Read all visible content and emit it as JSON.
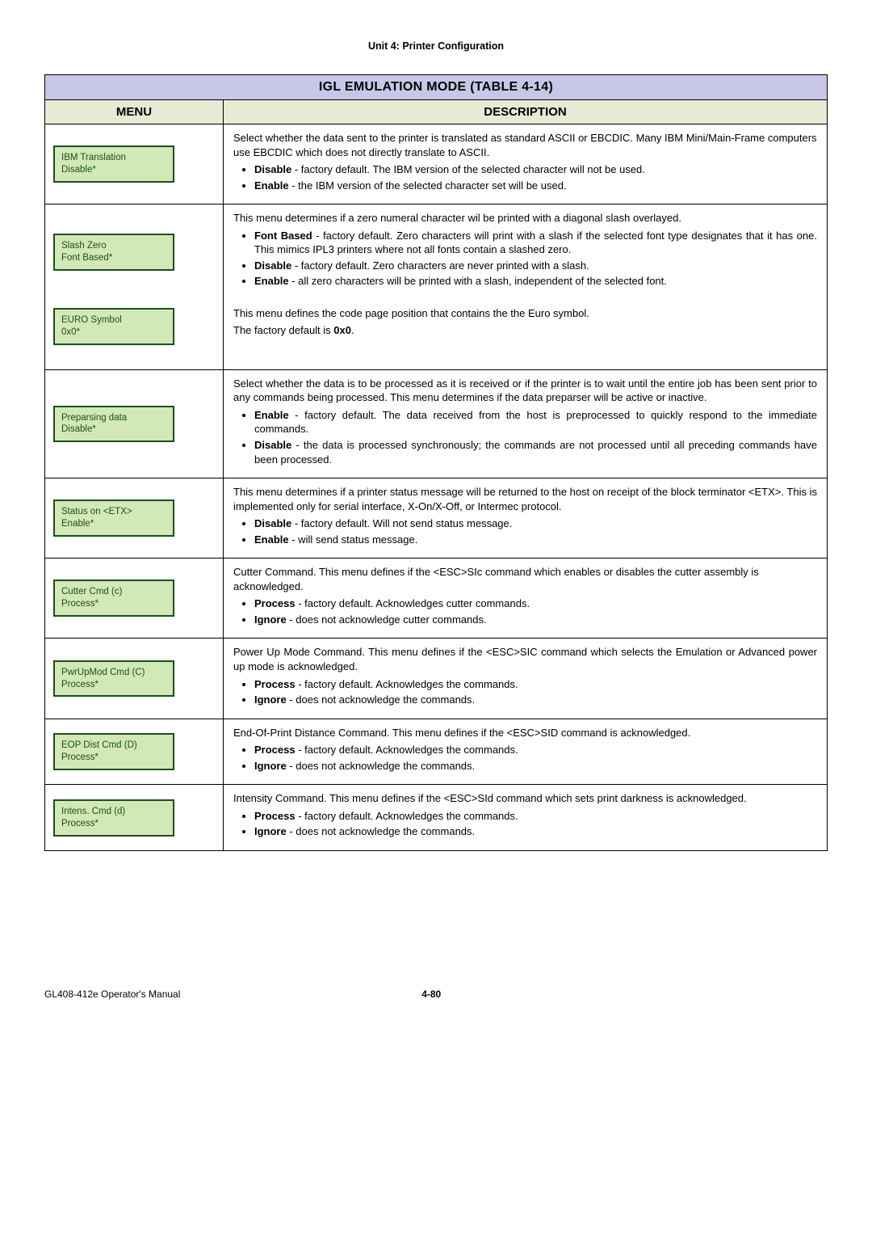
{
  "header": "Unit 4:  Printer Configuration",
  "table": {
    "title": "IGL EMULATION MODE (TABLE 4-14)",
    "col_menu": "MENU",
    "col_desc": "DESCRIPTION"
  },
  "rows": [
    {
      "menu_line1": "IBM Translation",
      "menu_line2": "Disable*",
      "intro": "Select whether the data sent to the printer is translated as standard ASCII or EBCDIC. Many IBM Mini/Main-Frame computers use EBCDIC which does not directly translate to ASCII.",
      "opts": [
        {
          "b": "Disable",
          "t": " - factory default. The IBM version of the selected character will not be used."
        },
        {
          "b": "Enable",
          "t": " - the IBM version of the selected character set will be used."
        }
      ]
    },
    {
      "menu_line1": "Slash Zero",
      "menu_line2": "Font Based*",
      "intro": "This menu determines if a zero numeral character wil be printed with a diagonal slash overlayed.",
      "opts": [
        {
          "b": "Font Based",
          "t": " - factory default. Zero characters will print with a slash if the selected font type designates that it has one. This mimics IPL3 printers where not all fonts contain a slashed zero."
        },
        {
          "b": "Disable",
          "t": " - factory default. Zero characters are never printed with a slash."
        },
        {
          "b": "Enable",
          "t": " - all zero characters will be printed with a slash, independent of the selected font."
        }
      ]
    },
    {
      "menu_line1": "EURO Symbol",
      "menu_line2": "0x0*",
      "intro": "This menu defines the code page position that contains the the Euro symbol.",
      "plain_pre": "The factory default is ",
      "plain_bold": "0x0",
      "plain_post": "."
    },
    {
      "menu_line1": "Preparsing data",
      "menu_line2": "Disable*",
      "intro": "Select whether the data is to be processed as it is received or if the printer is to wait until the entire job has been sent prior to any commands being processed. This menu determines if the data preparser will be active or inactive.",
      "opts": [
        {
          "b": "Enable",
          "t": " - factory default. The data received from the host is preprocessed to quickly respond to the immediate commands."
        },
        {
          "b": "Disable",
          "t": " - the data is processed synchronously; the commands are not processed until all preceding commands have been processed."
        }
      ]
    },
    {
      "menu_line1": "Status on <ETX>",
      "menu_line2": "Enable*",
      "intro": "This menu determines if a printer status message will be returned to the host on receipt of the block terminator <ETX>. This is implemented only for serial interface, X-On/X-Off, or Intermec protocol.",
      "opts": [
        {
          "b": "Disable",
          "t": " - factory default. Will not send status message."
        },
        {
          "b": "Enable",
          "t": " - will send status message."
        }
      ]
    },
    {
      "menu_line1": "Cutter Cmd (c)",
      "menu_line2": "Process*",
      "intro": "Cutter Command. This menu defines if the <ESC>SIc command which enables or disables the cutter assembly is acknowledged.",
      "opts": [
        {
          "b": "Process",
          "t": " - factory default. Acknowledges cutter commands."
        },
        {
          "b": "Ignore",
          "t": " - does not acknowledge cutter commands."
        }
      ]
    },
    {
      "menu_line1": "PwrUpMod Cmd (C)",
      "menu_line2": "Process*",
      "intro": "Power Up Mode Command. This menu defines if the <ESC>SIC command which selects the Emulation or Advanced power up mode is acknowledged.",
      "opts": [
        {
          "b": "Process",
          "t": " - factory default. Acknowledges the commands."
        },
        {
          "b": "Ignore",
          "t": " - does not acknowledge the commands."
        }
      ]
    },
    {
      "menu_line1": "EOP Dist Cmd (D)",
      "menu_line2": "Process*",
      "intro": "End-Of-Print Distance Command. This menu defines if the <ESC>SID command is acknowledged.",
      "opts": [
        {
          "b": "Process",
          "t": " - factory default. Acknowledges the commands."
        },
        {
          "b": "Ignore",
          "t": " - does not acknowledge the commands."
        }
      ]
    },
    {
      "menu_line1": "Intens. Cmd (d)",
      "menu_line2": "Process*",
      "intro": "Intensity Command. This menu defines if the <ESC>SId command which sets print darkness is acknowledged.",
      "opts": [
        {
          "b": "Process",
          "t": " - factory default. Acknowledges the commands."
        },
        {
          "b": "Ignore",
          "t": " - does not acknowledge the commands."
        }
      ]
    }
  ],
  "footer": {
    "left": "GL408-412e Operator's Manual",
    "center": "4-80"
  }
}
